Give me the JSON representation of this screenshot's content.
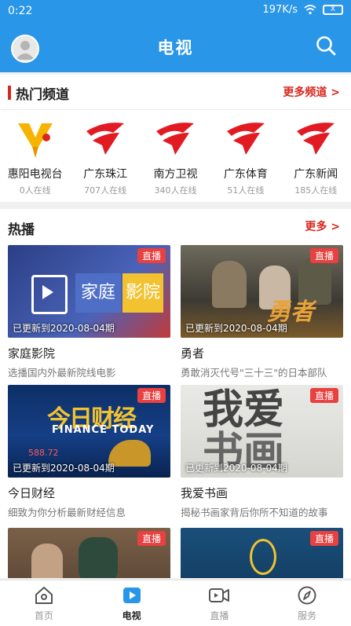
{
  "status": {
    "time": "0:22",
    "speed": "197K/s",
    "battery": "X"
  },
  "header": {
    "title": "电视"
  },
  "hot_channels": {
    "title": "热门频道",
    "more": "更多频道 >",
    "items": [
      {
        "name": "惠阳电视台",
        "count": "0人在线",
        "logo": "huiyang-logo"
      },
      {
        "name": "广东珠江",
        "count": "707人在线",
        "logo": "gdtv-logo"
      },
      {
        "name": "南方卫视",
        "count": "340人在线",
        "logo": "gdtv-logo"
      },
      {
        "name": "广东体育",
        "count": "51人在线",
        "logo": "gdtv-logo"
      },
      {
        "name": "广东新闻",
        "count": "185人在线",
        "logo": "gdtv-logo"
      }
    ]
  },
  "hot_broadcast": {
    "title": "热播",
    "more": "更多 >",
    "cards": [
      {
        "title": "家庭影院",
        "subtitle": "选播国内外最新院线电影",
        "update": "已更新到2020-08-04期",
        "badge": "直播",
        "thumb_text": "家庭影院"
      },
      {
        "title": "勇者",
        "subtitle": "勇敢消灭代号\"三十三\"的日本部队",
        "update": "已更新到2020-08-04期",
        "badge": "直播",
        "thumb_text": "勇者"
      },
      {
        "title": "今日财经",
        "subtitle": "细致为你分析最新财经信息",
        "update": "已更新到2020-08-04期",
        "badge": "直播",
        "thumb_text": "今日财经",
        "thumb_sub": "FINANCE TODAY",
        "thumb_num": "588.72"
      },
      {
        "title": "我爱书画",
        "subtitle": "揭秘书画家背后你所不知道的故事",
        "update": "已更新到2020-08-04期",
        "badge": "直播",
        "thumb_text": "我爱书画"
      },
      {
        "title": "",
        "subtitle": "",
        "update": "",
        "badge": "直播"
      },
      {
        "title": "",
        "subtitle": "",
        "update": "",
        "badge": "直播"
      }
    ]
  },
  "tabs": [
    {
      "label": "首页",
      "icon": "home-icon"
    },
    {
      "label": "电视",
      "icon": "tv-play-icon",
      "active": true
    },
    {
      "label": "直播",
      "icon": "video-camera-icon"
    },
    {
      "label": "服务",
      "icon": "compass-icon"
    }
  ]
}
